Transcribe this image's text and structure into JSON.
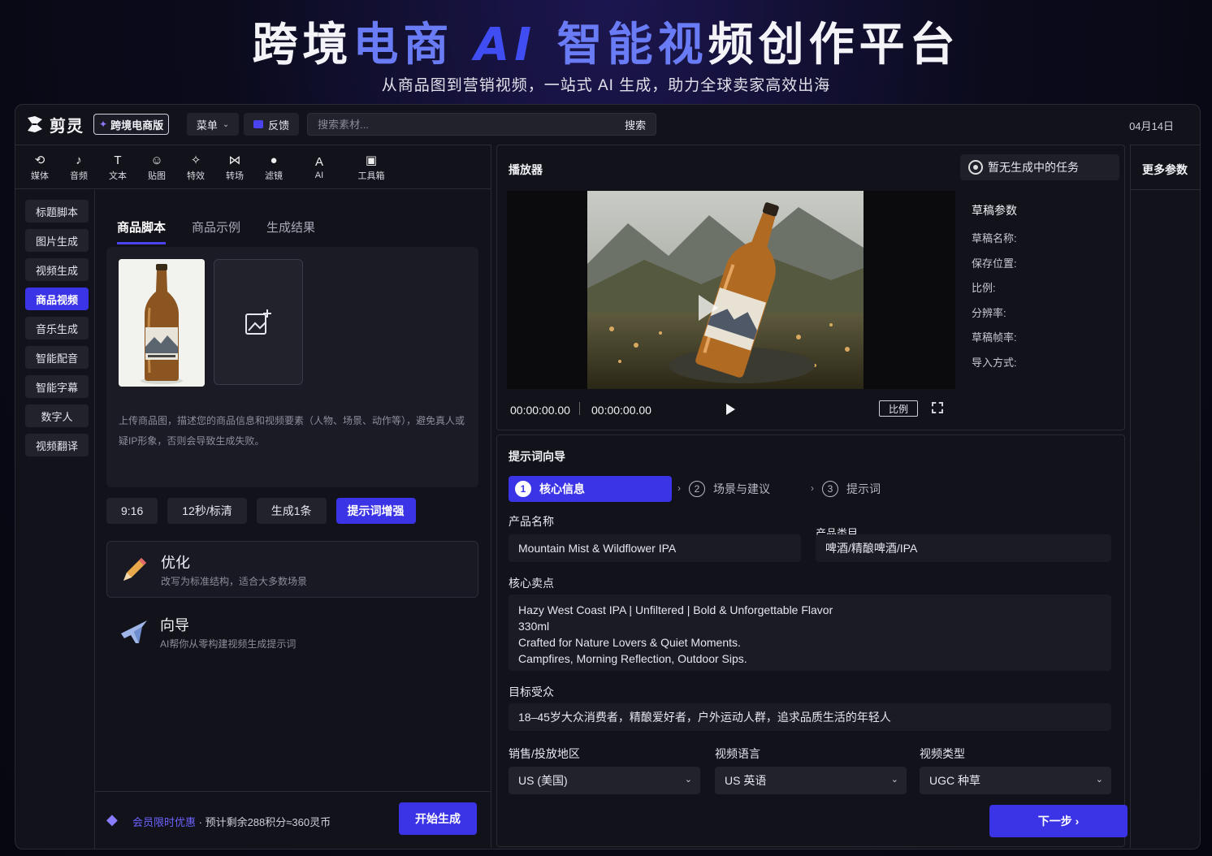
{
  "hero": {
    "title_part1": "跨境",
    "title_part2": "电商",
    "title_part3": "AI",
    "title_part4": "智能视",
    "title_part5": "频创作平台",
    "subtitle": "从商品图到营销视频，一站式 AI 生成，助力全球卖家高效出海"
  },
  "topbar": {
    "brand": "剪灵",
    "edition": "跨境电商版",
    "menu_label": "菜单",
    "feedback_label": "反馈",
    "search_placeholder": "搜索素材...",
    "search_button": "搜索",
    "date": "04月14日"
  },
  "toolbar": {
    "items": [
      {
        "label": "媒体",
        "icon": "media-icon"
      },
      {
        "label": "音频",
        "icon": "audio-icon"
      },
      {
        "label": "文本",
        "icon": "text-icon"
      },
      {
        "label": "贴图",
        "icon": "sticker-icon"
      },
      {
        "label": "特效",
        "icon": "effects-icon"
      },
      {
        "label": "转场",
        "icon": "transition-icon"
      },
      {
        "label": "滤镜",
        "icon": "filter-icon"
      },
      {
        "label": "AI",
        "icon": "ai-icon"
      },
      {
        "label": "工具箱",
        "icon": "toolbox-icon"
      }
    ]
  },
  "sidenav": {
    "items": [
      {
        "label": "标题脚本"
      },
      {
        "label": "图片生成"
      },
      {
        "label": "视频生成"
      },
      {
        "label": "商品视频",
        "active": true
      },
      {
        "label": "音乐生成"
      },
      {
        "label": "智能配音"
      },
      {
        "label": "智能字幕"
      },
      {
        "label": "数字人"
      },
      {
        "label": "视频翻译"
      }
    ]
  },
  "content": {
    "tabs": [
      "商品脚本",
      "商品示例",
      "生成结果"
    ],
    "product_label_text": "Mountain Mist & Wildflower IPA",
    "upload_hint": "上传商品图，描述您的商品信息和视频要素（人物、场景、动作等），避免真人或疑IP形象，否则会导致生成失败。",
    "options": [
      "9:16",
      "12秒/标清",
      "生成1条",
      "提示词增强"
    ],
    "modes": [
      {
        "title": "优化",
        "desc": "改写为标准结构，适合大多数场景",
        "icon": "pencil-icon"
      },
      {
        "title": "向导",
        "desc": "AI帮你从零构建视频生成提示词",
        "icon": "airplane-icon"
      }
    ],
    "promo_highlight": "会员限时优惠",
    "promo_text": " · 预计剩余288积分≈360灵币",
    "generate_button": "开始生成"
  },
  "player": {
    "title": "播放器",
    "task_status": "暂无生成中的任务",
    "time_current": "00:00:00.00",
    "time_total": "00:00:00.00",
    "ratio_button": "比例"
  },
  "draft": {
    "title": "草稿参数",
    "fields": [
      "草稿名称:",
      "保存位置:",
      "比例:",
      "分辨率:",
      "草稿帧率:",
      "导入方式:"
    ]
  },
  "more_params": "更多参数",
  "wizard": {
    "title": "提示词向导",
    "steps": [
      {
        "num": "1",
        "label": "核心信息"
      },
      {
        "num": "2",
        "label": "场景与建议"
      },
      {
        "num": "3",
        "label": "提示词"
      }
    ],
    "product_name_label": "产品名称",
    "product_name_value": "Mountain Mist & Wildflower IPA",
    "category_label": "产品类目",
    "category_value": "啤酒/精酿啤酒/IPA",
    "selling_points_label": "核心卖点",
    "selling_points_lines": [
      "Hazy West Coast IPA | Unfiltered | Bold & Unforgettable Flavor",
      "330ml",
      "Crafted for Nature Lovers & Quiet Moments.",
      "Campfires, Morning Reflection, Outdoor Sips."
    ],
    "audience_label": "目标受众",
    "audience_value": "18–45岁大众消费者，精酿爱好者，户外运动人群，追求品质生活的年轻人",
    "region_label": "销售/投放地区",
    "region_value": "US (美国)",
    "language_label": "视频语言",
    "language_value": "US 英语",
    "type_label": "视频类型",
    "type_value": "UGC 种草",
    "next_button": "下一步"
  },
  "colors": {
    "accent": "#3b34e6",
    "background": "#12121a",
    "panel": "#1b1b25"
  }
}
